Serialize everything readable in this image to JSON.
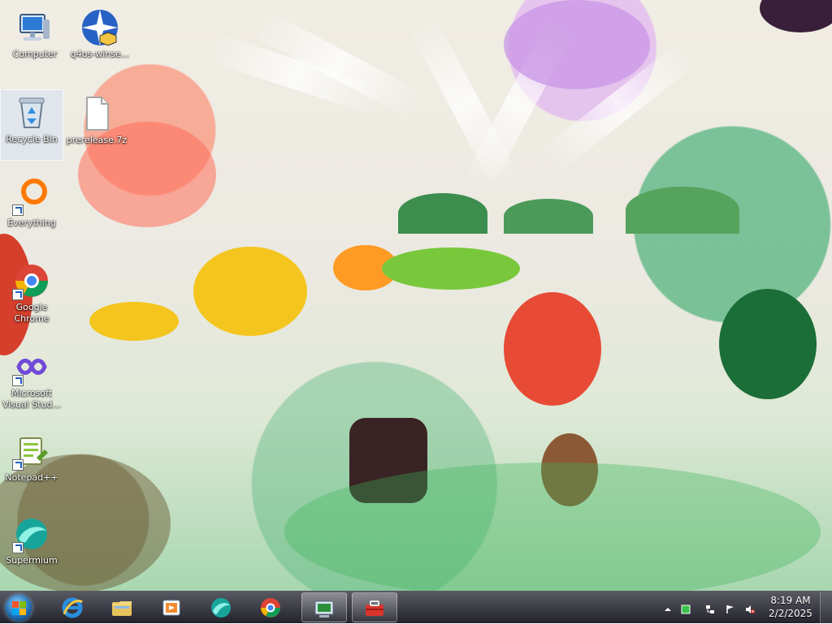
{
  "desktop_icons": [
    {
      "label": "Computer"
    },
    {
      "label": "q4os-winse..."
    },
    {
      "label": "Recycle Bin"
    },
    {
      "label": "prerelease.7z"
    },
    {
      "label": "Everything"
    },
    {
      "label": "Google Chrome"
    },
    {
      "label": "Microsoft Visual Stud..."
    },
    {
      "label": "Notepad++"
    },
    {
      "label": "Supermium"
    }
  ],
  "taskbar": {
    "pinned": [
      {
        "name": "Internet Explorer",
        "icon": "internet-explorer-icon"
      },
      {
        "name": "File Explorer",
        "icon": "folder-icon"
      },
      {
        "name": "Media Player",
        "icon": "media-player-icon"
      },
      {
        "name": "Supermium",
        "icon": "supermium-icon"
      },
      {
        "name": "Google Chrome",
        "icon": "chrome-icon"
      }
    ],
    "tray": {
      "time": "8:19 AM",
      "date": "2/2/2025"
    }
  },
  "colors": {
    "taskbar": "#2a2a35",
    "desktop_bg": "#ece9e2",
    "accent_blue": "#1f6db3"
  }
}
